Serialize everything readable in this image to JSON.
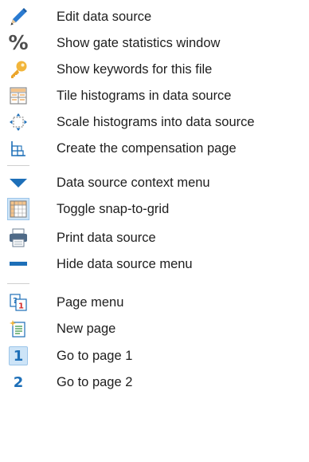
{
  "menu": {
    "items": [
      {
        "label": "Edit data source",
        "icon": "pencil-icon"
      },
      {
        "label": "Show gate statistics window",
        "icon": "percent-icon"
      },
      {
        "label": "Show keywords for this file",
        "icon": "key-icon"
      },
      {
        "label": "Tile histograms in data source",
        "icon": "tile-grid-icon"
      },
      {
        "label": "Scale histograms into data source",
        "icon": "scale-arrows-icon"
      },
      {
        "label": "Create the compensation page",
        "icon": "compensation-icon"
      },
      {
        "label": "Data source context menu",
        "icon": "triangle-down-icon"
      },
      {
        "label": "Toggle snap-to-grid",
        "icon": "snap-grid-icon"
      },
      {
        "label": "Print data source",
        "icon": "printer-icon"
      },
      {
        "label": "Hide data source menu",
        "icon": "minus-icon"
      },
      {
        "label": "Page menu",
        "icon": "page-menu-icon"
      },
      {
        "label": "New page",
        "icon": "new-page-icon"
      },
      {
        "label": "Go to page 1",
        "icon": "page-one-icon",
        "number": "1"
      },
      {
        "label": "Go to page 2",
        "icon": "page-two-icon",
        "number": "2"
      }
    ]
  },
  "symbols": {
    "percent": "%"
  },
  "colors": {
    "accent_blue": "#1d6fb8",
    "key_gold": "#f2b53a",
    "separator": "#cfcfcf"
  }
}
